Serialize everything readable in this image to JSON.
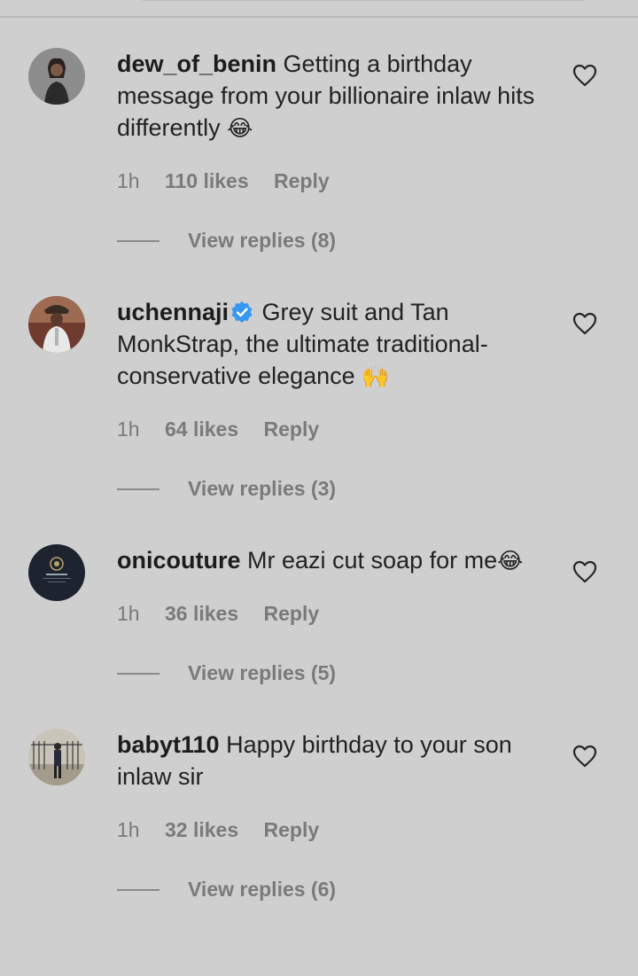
{
  "comments": [
    {
      "username": "dew_of_benin",
      "text": "Getting a birthday message from your billionaire inlaw hits differently",
      "emoji": "😂",
      "time": "1h",
      "likes": "110 likes",
      "reply": "Reply",
      "view_replies": "View replies (8)"
    },
    {
      "username": "uchennaji",
      "verified": true,
      "text": "Grey suit and Tan MonkStrap, the ultimate traditional-conservative elegance",
      "emoji": "🙌",
      "time": "1h",
      "likes": "64 likes",
      "reply": "Reply",
      "view_replies": "View replies (3)"
    },
    {
      "username": "onicouture",
      "text": "Mr eazi cut soap for me",
      "emoji": "😂",
      "time": "1h",
      "likes": "36 likes",
      "reply": "Reply",
      "view_replies": "View replies (5)"
    },
    {
      "username": "babyt110",
      "text": "Happy birthday to your son inlaw sir",
      "emoji": "",
      "time": "1h",
      "likes": "32 likes",
      "reply": "Reply",
      "view_replies": "View replies (6)"
    }
  ],
  "icons": {
    "like": "heart-outline-icon",
    "verified": "verified-badge-icon"
  },
  "colors": {
    "background": "#cfcfcf",
    "verified": "#3897f0",
    "muted_text": "#7a7a7a"
  }
}
